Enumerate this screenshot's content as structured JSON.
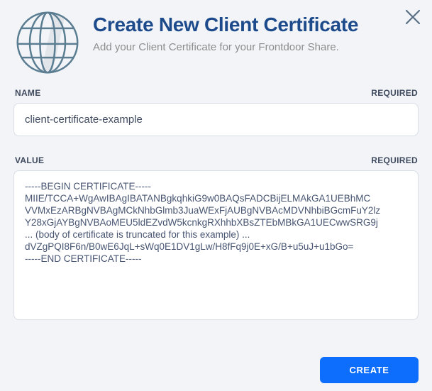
{
  "modal": {
    "title": "Create New Client Certificate",
    "subtitle": "Add your Client Certificate for your Frontdoor Share."
  },
  "fields": {
    "name": {
      "label": "NAME",
      "required_label": "REQUIRED",
      "value": "client-certificate-example"
    },
    "value": {
      "label": "VALUE",
      "required_label": "REQUIRED",
      "value": "-----BEGIN CERTIFICATE-----\nMIIE/TCCA+WgAwIBAgIBATANBgkqhkiG9w0BAQsFADCBijELMAkGA1UEBhMC\nVVMxEzARBgNVBAgMCkNhbGlmb3JuaWExFjAUBgNVBAcMDVNhbiBGcmFuY2lz\nY28xGjAYBgNVBAoMEU5ldEZvdW5kcnkgRXhhbXBsZTEbMBkGA1UECwwSRG9j\n... (body of certificate is truncated for this example) ...\ndVZgPQI8F6n/B0wE6JqL+sWq0E1DV1gLw/H8fFq9j0E+xG/B+u5uJ+u1bGo=\n-----END CERTIFICATE-----"
    }
  },
  "footer": {
    "create_label": "CREATE"
  },
  "icons": {
    "globe": "globe-icon",
    "close": "close-icon"
  },
  "colors": {
    "title_navy": "#1c4a8a",
    "accent_blue": "#0d6efd",
    "label_slate": "#3f4a5e",
    "globe_stroke": "#5b7d92",
    "background": "#f2f4f8",
    "field_border": "#d9dee6"
  }
}
